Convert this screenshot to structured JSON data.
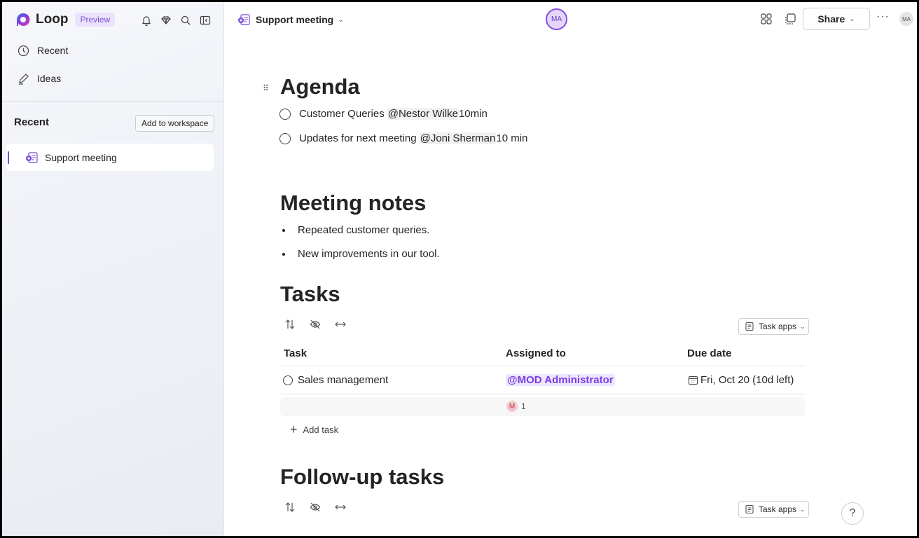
{
  "app": {
    "name": "Loop",
    "badge": "Preview"
  },
  "sidebar": {
    "nav": [
      {
        "label": "Recent",
        "icon": "clock-icon"
      },
      {
        "label": "Ideas",
        "icon": "pen-icon"
      }
    ],
    "recent_heading": "Recent",
    "add_to_workspace": "Add to workspace",
    "recent_items": [
      {
        "label": "Support meeting",
        "icon": "loop-page-icon"
      }
    ]
  },
  "header": {
    "doc_title": "Support meeting",
    "center_avatar": "MA",
    "share_label": "Share",
    "more_label": "···",
    "user_avatar": "MA"
  },
  "content": {
    "agenda": {
      "heading": "Agenda",
      "items": [
        {
          "text": "Customer Queries",
          "mention": "@Nestor Wilke",
          "suffix": "10min"
        },
        {
          "text": "Updates for next meeting",
          "mention": "@Joni Sherman",
          "suffix": "10 min"
        }
      ]
    },
    "notes": {
      "heading": "Meeting notes",
      "bullets": [
        "Repeated customer queries.",
        "New improvements in our tool."
      ]
    },
    "tasks": {
      "heading": "Tasks",
      "task_apps_label": "Task apps",
      "columns": [
        "Task",
        "Assigned to",
        "Due date"
      ],
      "rows": [
        {
          "task": "Sales management",
          "assigned": "@MOD Administrator",
          "due": "Fri, Oct 20 (10d left)"
        }
      ],
      "summary": {
        "initial": "M",
        "count": "1"
      },
      "add_task_label": "Add task"
    },
    "followup": {
      "heading": "Follow-up tasks",
      "task_apps_label": "Task apps"
    }
  },
  "help_label": "?",
  "colors": {
    "accent": "#7a4ad6",
    "mention_bg": "#efe7fd"
  }
}
